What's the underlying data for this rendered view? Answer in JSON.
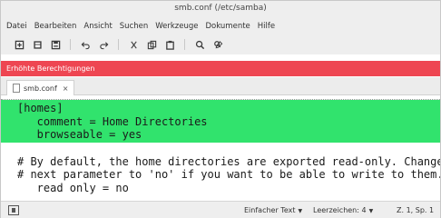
{
  "window": {
    "title": "smb.conf (/etc/samba)"
  },
  "menubar": {
    "items": [
      "Datei",
      "Bearbeiten",
      "Ansicht",
      "Suchen",
      "Werkzeuge",
      "Dokumente",
      "Hilfe"
    ]
  },
  "toolbar": {
    "buttons": [
      "new-document-icon",
      "open-icon",
      "save-icon",
      "undo-icon",
      "redo-icon",
      "cut-icon",
      "copy-icon",
      "paste-icon",
      "search-icon",
      "replace-icon"
    ]
  },
  "infobar": {
    "text": "Erhöhte Berechtigungen"
  },
  "tabs": [
    {
      "label": "smb.conf",
      "close": "×"
    }
  ],
  "editor": {
    "lines": [
      "[homes]",
      "   comment = Home Directories",
      "   browseable = yes",
      "",
      "# By default, the home directories are exported read-only. Change the",
      "# next parameter to 'no' if you want to be able to write to them.",
      "   read only = no"
    ],
    "highlight_color": "#31e36d"
  },
  "statusbar": {
    "syntax": "Einfacher Text",
    "indent": "Leerzeichen: 4",
    "position": "Z. 1, Sp. 1"
  },
  "colors": {
    "infobar_bg": "#ee4652",
    "chrome_bg": "#eeeeee"
  }
}
